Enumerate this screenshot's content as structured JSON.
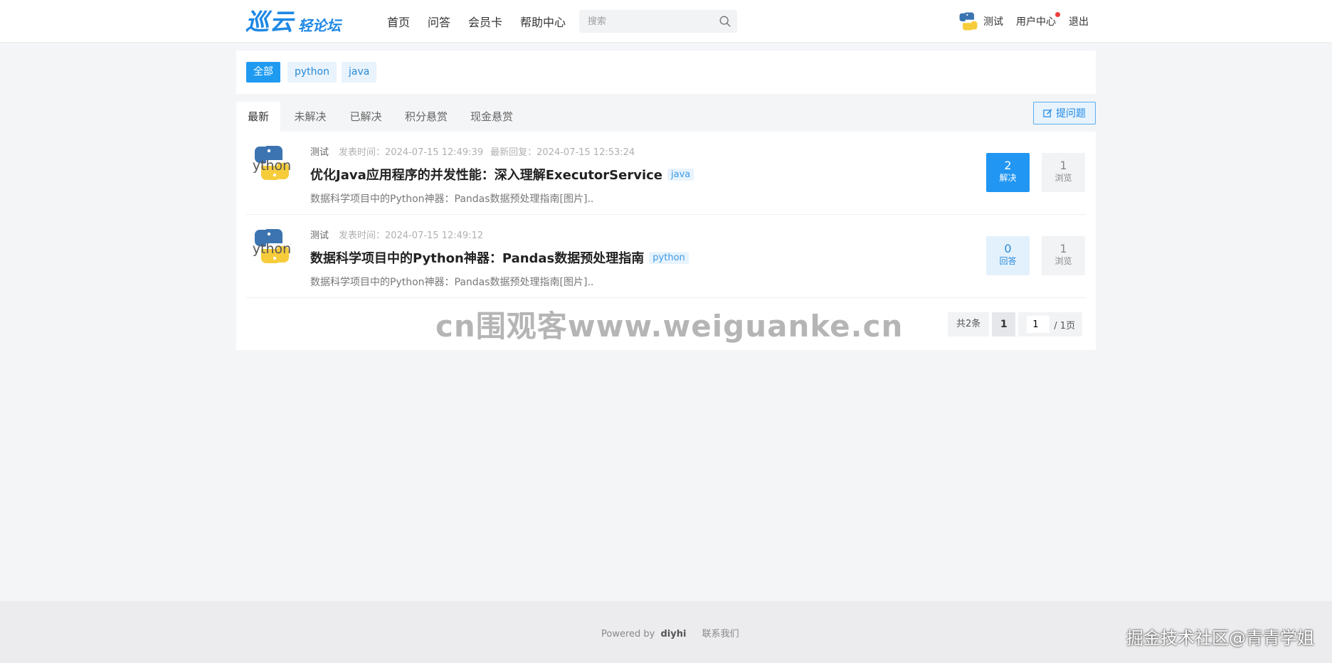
{
  "header": {
    "logo_main": "巡云",
    "logo_sub": "轻论坛",
    "nav": [
      "首页",
      "问答",
      "会员卡",
      "帮助中心"
    ],
    "search_placeholder": "搜索",
    "username": "测试",
    "user_center": "用户中心",
    "logout": "退出"
  },
  "tags": [
    "全部",
    "python",
    "java"
  ],
  "tabs": [
    "最新",
    "未解决",
    "已解决",
    "积分悬赏",
    "现金悬赏"
  ],
  "ask_button": "提问题",
  "questions": [
    {
      "author": "测试",
      "posted_label": "发表时间：",
      "posted_time": "2024-07-15 12:49:39",
      "reply_label": "最新回复：",
      "reply_time": "2024-07-15 12:53:24",
      "title": "优化Java应用程序的并发性能：深入理解ExecutorService",
      "tag": "java",
      "excerpt": "数据科学项目中的Python神器：Pandas数据预处理指南[图片]..",
      "stat1_value": "2",
      "stat1_label": "解决",
      "views_value": "1",
      "views_label": "浏览"
    },
    {
      "author": "测试",
      "posted_label": "发表时间：",
      "posted_time": "2024-07-15 12:49:12",
      "title": "数据科学项目中的Python神器：Pandas数据预处理指南",
      "tag": "python",
      "excerpt": "数据科学项目中的Python神器：Pandas数据预处理指南[图片]..",
      "stat1_value": "0",
      "stat1_label": "回答",
      "views_value": "1",
      "views_label": "浏览"
    }
  ],
  "pager": {
    "total": "共2条",
    "current": "1",
    "jump_value": "1",
    "pages_suffix": "/ 1页"
  },
  "watermark": "cn围观客www.weiguanke.cn",
  "footer": {
    "powered_by": "Powered by",
    "brand": "diyhi",
    "contact": "联系我们"
  },
  "corner_mark": "掘金技术社区@青青学姐",
  "colors": {
    "accent": "#1e9bf0",
    "solved_bg": "#2196f3",
    "tag_bg": "#e8f3fd",
    "page_bg": "#f4f5f7"
  }
}
